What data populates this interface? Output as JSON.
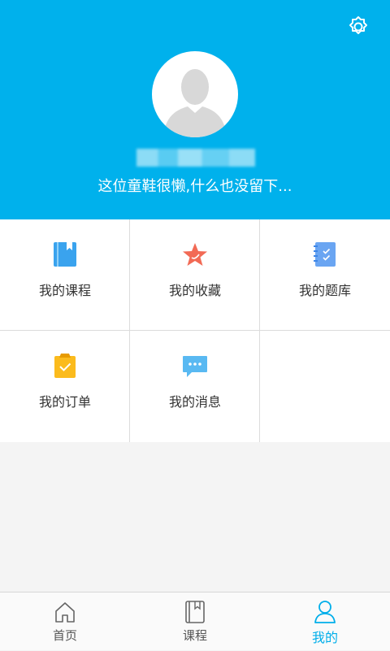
{
  "header": {
    "username": "",
    "signature": "这位童鞋很懒,什么也没留下...",
    "settings_icon": "gear-icon",
    "avatar_icon": "default-avatar-icon"
  },
  "menu": {
    "items": [
      {
        "label": "我的课程",
        "icon": "book-icon",
        "color": "#3aa3ee"
      },
      {
        "label": "我的收藏",
        "icon": "star-icon",
        "color": "#f26a55"
      },
      {
        "label": "我的题库",
        "icon": "notebook-icon",
        "color": "#6aa5f2"
      },
      {
        "label": "我的订单",
        "icon": "clipboard-icon",
        "color": "#fbbb1d"
      },
      {
        "label": "我的消息",
        "icon": "chat-bubble-icon",
        "color": "#59b9f2"
      }
    ]
  },
  "tabbar": {
    "tabs": [
      {
        "label": "首页",
        "icon": "home-icon",
        "active": false
      },
      {
        "label": "课程",
        "icon": "book-icon",
        "active": false
      },
      {
        "label": "我的",
        "icon": "person-icon",
        "active": true
      }
    ]
  },
  "colors": {
    "header_bg": "#00b1ec",
    "accent": "#00aeea",
    "page_bg": "#f4f4f4"
  }
}
